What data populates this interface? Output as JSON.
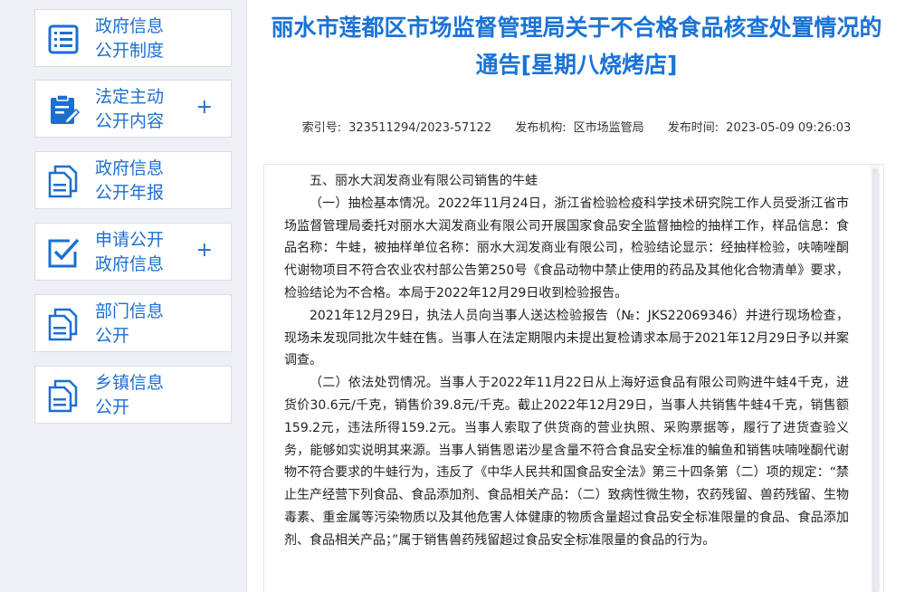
{
  "sidebar": {
    "items": [
      {
        "label": "政府信息\n公开制度",
        "icon": "list-document-icon",
        "plus": ""
      },
      {
        "label": "法定主动\n公开内容",
        "icon": "clipboard-edit-icon",
        "plus": "+"
      },
      {
        "label": "政府信息\n公开年报",
        "icon": "documents-icon",
        "plus": ""
      },
      {
        "label": "申请公开\n政府信息",
        "icon": "check-edit-icon",
        "plus": "+"
      },
      {
        "label": "部门信息\n公开",
        "icon": "documents-icon",
        "plus": ""
      },
      {
        "label": "乡镇信息\n公开",
        "icon": "documents-icon",
        "plus": ""
      }
    ]
  },
  "article": {
    "title": "丽水市莲都区市场监督管理局关于不合格食品核查处置情况的通告[星期八烧烤店]",
    "meta": {
      "index_label": "索引号:",
      "index_value": "323511294/2023-57122",
      "org_label": "发布机构:",
      "org_value": "区市场监管局",
      "time_label": "发布时间:",
      "time_value": "2023-05-09 09:26:03"
    },
    "paragraphs": [
      "五、丽水大润发商业有限公司销售的牛蛙",
      "（一）抽检基本情况。2022年11月24日，浙江省检验检疫科学技术研究院工作人员受浙江省市场监督管理局委托对丽水大润发商业有限公司开展国家食品安全监督抽检的抽样工作，样品信息：食品名称：牛蛙，被抽样单位名称：丽水大润发商业有限公司，检验结论显示：经抽样检验，呋喃唑酮代谢物项目不符合农业农村部公告第250号《食品动物中禁止使用的药品及其他化合物清单》要求，检验结论为不合格。本局于2022年12月29日收到检验报告。",
      "2021年12月29日，执法人员向当事人送达检验报告（№：JKS22069346）并进行现场检查，现场未发现同批次牛蛙在售。当事人在法定期限内未提出复检请求本局于2021年12月29日予以并案调查。",
      "（二）依法处罚情况。当事人于2022年11月22日从上海好运食品有限公司购进牛蛙4千克，进货价30.6元/千克，销售价39.8元/千克。截止2022年12月29日，当事人共销售牛蛙4千克，销售额159.2元，违法所得159.2元。当事人索取了供货商的营业执照、采购票据等，履行了进货查验义务，能够如实说明其来源。当事人销售恩诺沙星含量不符合食品安全标准的鳊鱼和销售呋喃唑酮代谢物不符合要求的牛蛙行为，违反了《中华人民共和国食品安全法》第三十四条第（二）项的规定：“禁止生产经营下列食品、食品添加剂、食品相关产品：（二）致病性微生物，农药残留、兽药残留、生物毒素、重金属等污染物质以及其他危害人体健康的物质含量超过食品安全标准限量的食品、食品添加剂、食品相关产品；”属于销售兽药残留超过食品安全标准限量的食品的行为。"
    ]
  }
}
